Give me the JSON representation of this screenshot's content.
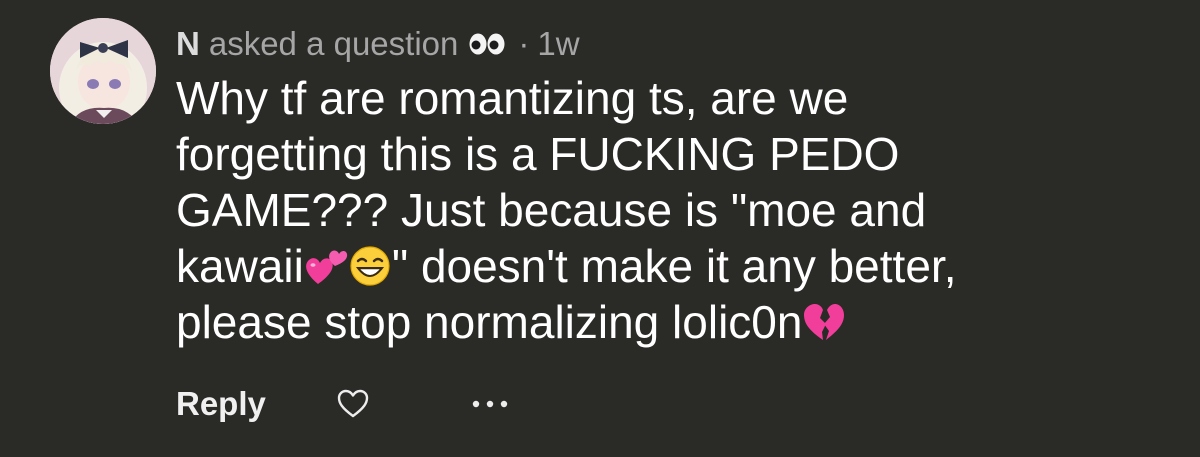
{
  "comment": {
    "username": "N",
    "action": "asked a question",
    "action_icon": "eyes-emoji",
    "separator": "·",
    "time": "1w",
    "body_lines": [
      {
        "text": "Why tf are romantizing ts, are we"
      },
      {
        "text": "forgetting this is a FUCKING PEDO"
      },
      {
        "text": "GAME??? Just because is \"moe and"
      },
      {
        "text_before": "kawaii",
        "text_after": "\" doesn't make it any better,"
      },
      {
        "text": "please stop normalizing lolic0n"
      }
    ],
    "emojis": [
      "two-hearts",
      "grinning-face",
      "broken-heart"
    ]
  },
  "actions": {
    "reply_label": "Reply",
    "like_icon": "heart-outline-icon",
    "more_icon": "more-dots-icon"
  },
  "colors": {
    "background": "#2a2a27",
    "text": "#ffffff",
    "muted": "#a6a6a6"
  }
}
